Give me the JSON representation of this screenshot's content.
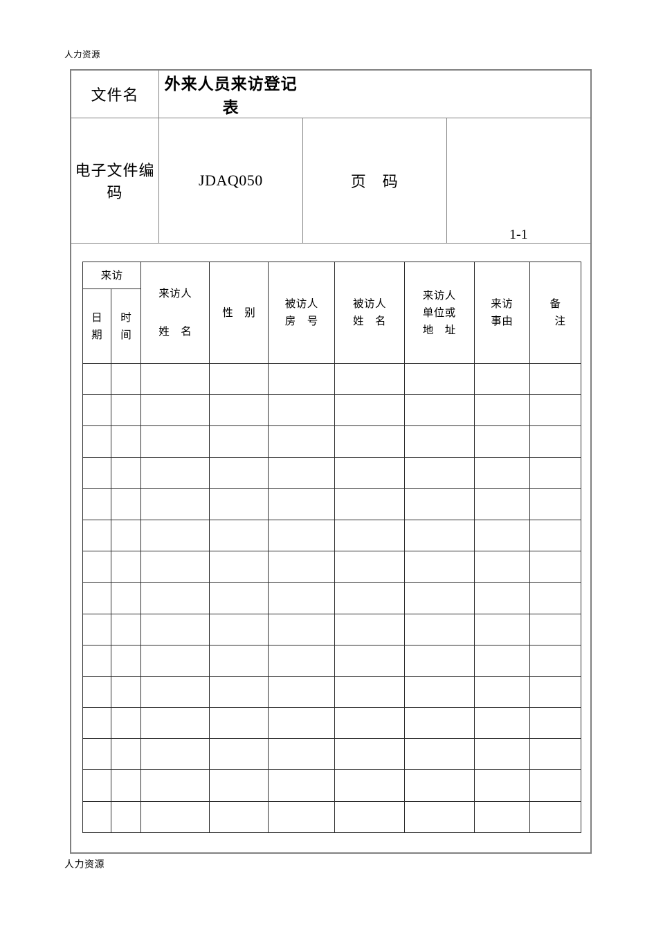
{
  "page": {
    "running_header": "人力资源",
    "running_footer": "人力资源"
  },
  "header_block": {
    "filename_label": "文件名",
    "document_title": "外来人员来访登记表",
    "code_label": "电子文件编码",
    "code_value": "JDAQ050",
    "page_label": "页　码",
    "page_value": "1-1"
  },
  "grid": {
    "columns": [
      {
        "key": "visit_date",
        "group": "来访",
        "line1": "日",
        "line2": "期"
      },
      {
        "key": "visit_time",
        "group": "来访",
        "line1": "时",
        "line2": "间"
      },
      {
        "key": "visitor_name",
        "line1": "来访人",
        "line2": "姓　名"
      },
      {
        "key": "gender",
        "line1": "性　别",
        "line2": ""
      },
      {
        "key": "host_room",
        "line1": "被访人",
        "line2": "房　号"
      },
      {
        "key": "host_name",
        "line1": "被访人",
        "line2": "姓　名"
      },
      {
        "key": "visitor_org",
        "line1": "来访人",
        "line2": "单位或",
        "line3": "地　址"
      },
      {
        "key": "visit_reason",
        "line1": "来访",
        "line2": "事由"
      },
      {
        "key": "remark",
        "line1": "备",
        "line2": "注"
      }
    ],
    "group_header": "来访",
    "row_count": 15,
    "rows": [
      {
        "visit_date": "",
        "visit_time": "",
        "visitor_name": "",
        "gender": "",
        "host_room": "",
        "host_name": "",
        "visitor_org": "",
        "visit_reason": "",
        "remark": ""
      },
      {
        "visit_date": "",
        "visit_time": "",
        "visitor_name": "",
        "gender": "",
        "host_room": "",
        "host_name": "",
        "visitor_org": "",
        "visit_reason": "",
        "remark": ""
      },
      {
        "visit_date": "",
        "visit_time": "",
        "visitor_name": "",
        "gender": "",
        "host_room": "",
        "host_name": "",
        "visitor_org": "",
        "visit_reason": "",
        "remark": ""
      },
      {
        "visit_date": "",
        "visit_time": "",
        "visitor_name": "",
        "gender": "",
        "host_room": "",
        "host_name": "",
        "visitor_org": "",
        "visit_reason": "",
        "remark": ""
      },
      {
        "visit_date": "",
        "visit_time": "",
        "visitor_name": "",
        "gender": "",
        "host_room": "",
        "host_name": "",
        "visitor_org": "",
        "visit_reason": "",
        "remark": ""
      },
      {
        "visit_date": "",
        "visit_time": "",
        "visitor_name": "",
        "gender": "",
        "host_room": "",
        "host_name": "",
        "visitor_org": "",
        "visit_reason": "",
        "remark": ""
      },
      {
        "visit_date": "",
        "visit_time": "",
        "visitor_name": "",
        "gender": "",
        "host_room": "",
        "host_name": "",
        "visitor_org": "",
        "visit_reason": "",
        "remark": ""
      },
      {
        "visit_date": "",
        "visit_time": "",
        "visitor_name": "",
        "gender": "",
        "host_room": "",
        "host_name": "",
        "visitor_org": "",
        "visit_reason": "",
        "remark": ""
      },
      {
        "visit_date": "",
        "visit_time": "",
        "visitor_name": "",
        "gender": "",
        "host_room": "",
        "host_name": "",
        "visitor_org": "",
        "visit_reason": "",
        "remark": ""
      },
      {
        "visit_date": "",
        "visit_time": "",
        "visitor_name": "",
        "gender": "",
        "host_room": "",
        "host_name": "",
        "visitor_org": "",
        "visit_reason": "",
        "remark": ""
      },
      {
        "visit_date": "",
        "visit_time": "",
        "visitor_name": "",
        "gender": "",
        "host_room": "",
        "host_name": "",
        "visitor_org": "",
        "visit_reason": "",
        "remark": ""
      },
      {
        "visit_date": "",
        "visit_time": "",
        "visitor_name": "",
        "gender": "",
        "host_room": "",
        "host_name": "",
        "visitor_org": "",
        "visit_reason": "",
        "remark": ""
      },
      {
        "visit_date": "",
        "visit_time": "",
        "visitor_name": "",
        "gender": "",
        "host_room": "",
        "host_name": "",
        "visitor_org": "",
        "visit_reason": "",
        "remark": ""
      },
      {
        "visit_date": "",
        "visit_time": "",
        "visitor_name": "",
        "gender": "",
        "host_room": "",
        "host_name": "",
        "visitor_org": "",
        "visit_reason": "",
        "remark": ""
      },
      {
        "visit_date": "",
        "visit_time": "",
        "visitor_name": "",
        "gender": "",
        "host_room": "",
        "host_name": "",
        "visitor_org": "",
        "visit_reason": "",
        "remark": ""
      }
    ]
  },
  "colors": {
    "frame": "#808080",
    "grid_line": "#2b2b2b",
    "text": "#000000",
    "background": "#ffffff"
  }
}
